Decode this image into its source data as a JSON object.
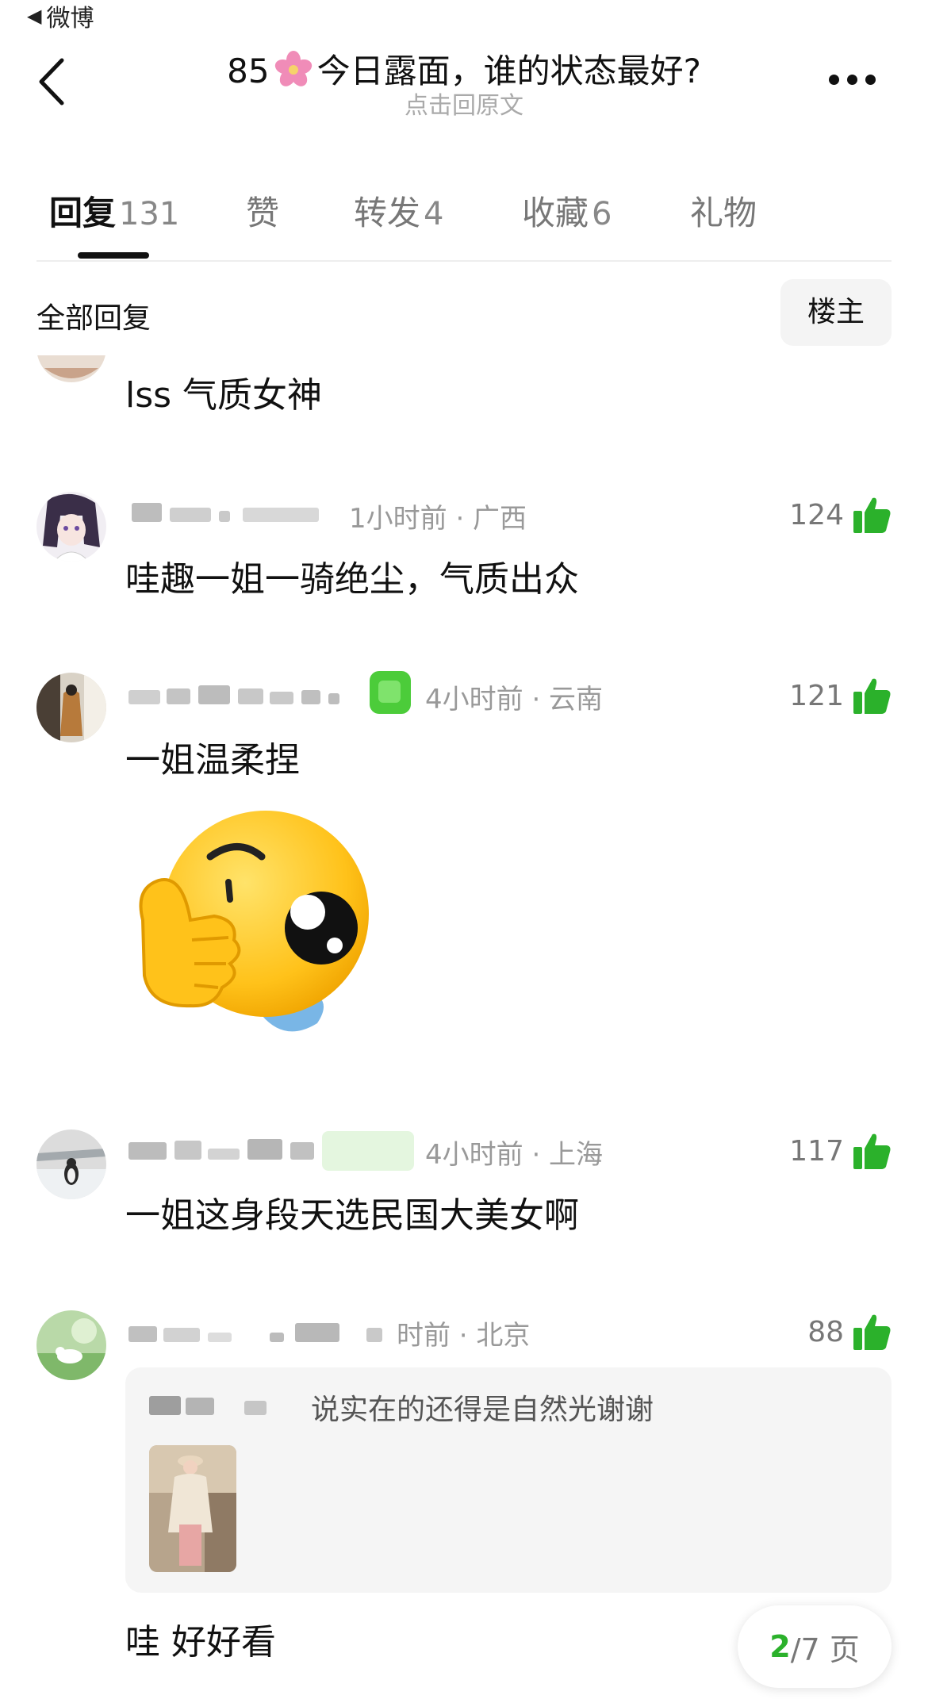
{
  "status": {
    "back_app": "微博"
  },
  "header": {
    "title": "85🌸今日露面，谁的状态最好?",
    "title_prefix": "85",
    "title_suffix": "今日露面，谁的状态最好?",
    "subtitle": "点击回原文"
  },
  "tabs": [
    {
      "label": "回复",
      "count": "131",
      "active": true
    },
    {
      "label": "赞",
      "count": ""
    },
    {
      "label": "转发",
      "count": "4"
    },
    {
      "label": "收藏",
      "count": "6"
    },
    {
      "label": "礼物",
      "count": ""
    }
  ],
  "filter": {
    "label": "全部回复",
    "owner_button": "楼主"
  },
  "comments": [
    {
      "text": "lss 气质女神"
    },
    {
      "meta": "1小时前 · 广西",
      "likes": "124",
      "text": "哇趣一姐一骑绝尘，气质出众"
    },
    {
      "meta": "4小时前 · 云南",
      "likes": "121",
      "text": "一姐温柔捏",
      "has_sticker": true
    },
    {
      "meta": "4小时前 · 上海",
      "likes": "117",
      "text": "一姐这身段天选民国大美女啊"
    },
    {
      "meta": "时前 · 北京",
      "likes": "88",
      "text": "哇 好好看",
      "quoted_reply": {
        "text": "说实在的还得是自然光谢谢"
      }
    }
  ],
  "pager": {
    "current": "2",
    "total_label": "/7 页"
  },
  "colors": {
    "like_green": "#2bb12b",
    "badge_green": "#4ccc3a",
    "text": "#111111",
    "muted": "#999999"
  }
}
